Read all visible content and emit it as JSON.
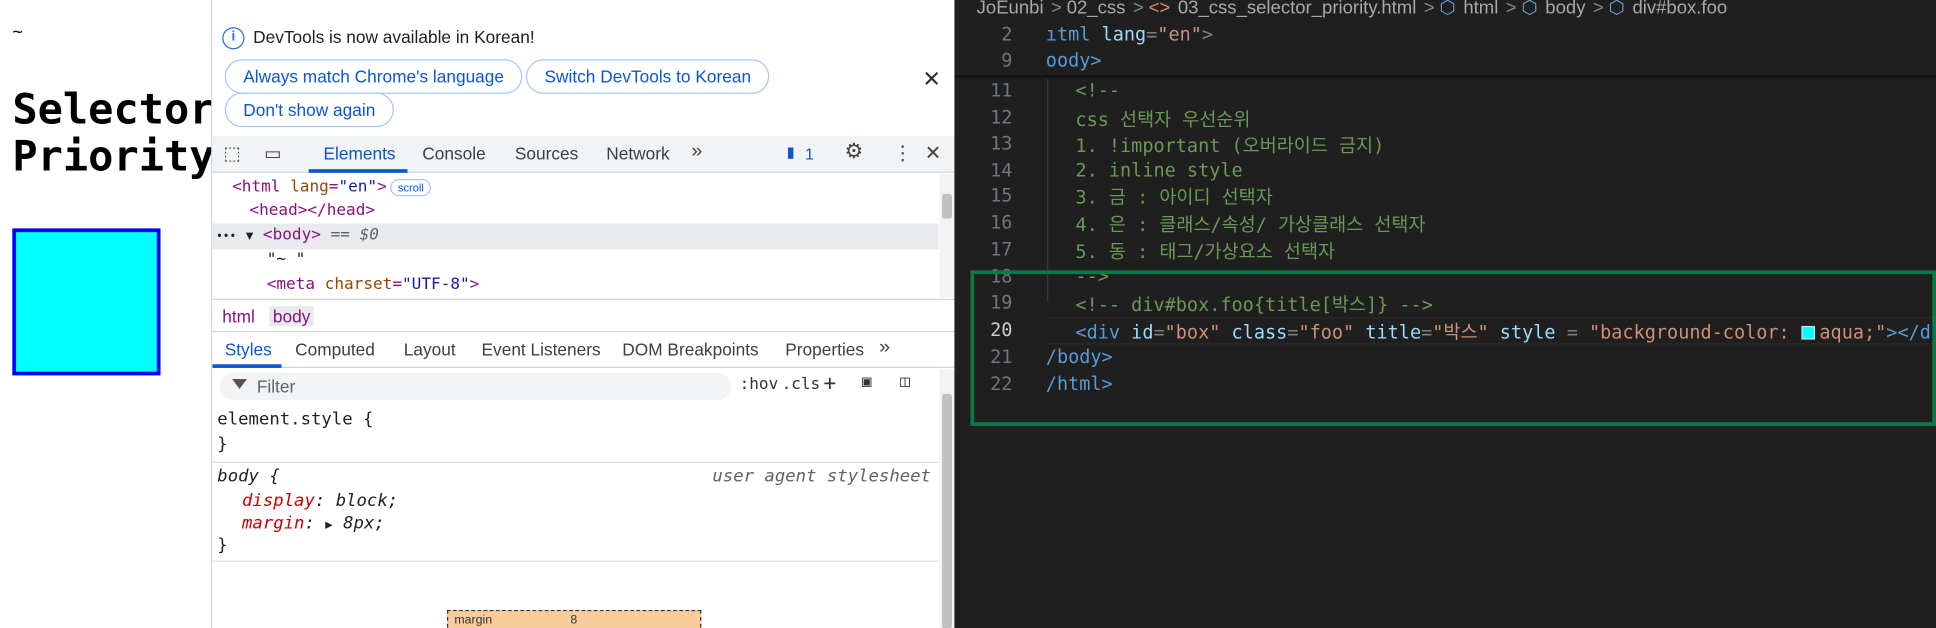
{
  "page": {
    "tilde": "~",
    "heading_line1": "Selector",
    "heading_line2": "Priority",
    "box_color": "#00ffff",
    "box_border_color": "#0000ff"
  },
  "devtools": {
    "infobar": {
      "message": "DevTools is now available in Korean!",
      "btn_match": "Always match Chrome's language",
      "btn_switch": "Switch DevTools to Korean",
      "btn_dont_show": "Don't show again"
    },
    "tabs": [
      "Elements",
      "Console",
      "Sources",
      "Network"
    ],
    "issues_count": "1",
    "elements": {
      "html_open_tag": "<html ",
      "html_attr_name": "lang",
      "html_attr_eq": "=",
      "html_attr_value": "\"en\"",
      "html_close_bracket": ">",
      "scroll_badge": "scroll",
      "head": "<head></head>",
      "body_dots": "•••",
      "body_arrow": "▼",
      "body_tag": "<body>",
      "body_ref": "== $0",
      "text_node": "\"~ \"",
      "meta_open": "<meta ",
      "meta_attr": "charset",
      "meta_eq": "=",
      "meta_value": "\"UTF-8\"",
      "meta_close": ">"
    },
    "breadcrumbs": [
      "html",
      "body"
    ],
    "subtabs": [
      "Styles",
      "Computed",
      "Layout",
      "Event Listeners",
      "DOM Breakpoints",
      "Properties"
    ],
    "filter_placeholder": "Filter",
    "tools": {
      "hov": ":hov",
      "cls": ".cls"
    },
    "styles": {
      "element_style": "element.style {",
      "close_brace": "}",
      "body_rule": "body {",
      "user_agent": "user agent stylesheet",
      "display_prop": "display",
      "display_val": "block;",
      "margin_prop": "margin",
      "margin_val": "8px;",
      "colon": ":",
      "expand_arrow": "▶"
    },
    "box_model": {
      "label": "margin",
      "value": "8"
    }
  },
  "vscode": {
    "breadcrumb": [
      "JoEunbi",
      "02_css",
      "03_css_selector_priority.html",
      "html",
      "body",
      "div#box.foo"
    ],
    "active_line": "20",
    "lines": [
      {
        "n": "2",
        "a": "ıtml ",
        "b": "lang",
        "c": "=",
        "d": "\"en\"",
        "e": ">"
      },
      {
        "n": "9",
        "a": "oody>"
      },
      {
        "n": "11",
        "text": "<!--"
      },
      {
        "n": "12",
        "text": "css 선택자 우선순위"
      },
      {
        "n": "13",
        "text": "1. !important (오버라이드 금지)"
      },
      {
        "n": "14",
        "text": "2. inline style"
      },
      {
        "n": "15",
        "text": "3. 금 : 아이디 선택자"
      },
      {
        "n": "16",
        "text": "4. 은 : 클래스/속성/ 가상클래스 선택자"
      },
      {
        "n": "17",
        "text": "5. 동 : 태그/가상요소 선택자"
      },
      {
        "n": "18",
        "text": "-->"
      },
      {
        "n": "19",
        "text": "<!-- div#box.foo{title[박스]} -->"
      },
      {
        "n": "20",
        "t1": "<div ",
        "id_n": "id",
        "id_v": "\"box\"",
        "cls_n": "class",
        "cls_v": "\"foo\"",
        "title_n": "title",
        "title_v": "\"박스\"",
        "style_n": "style",
        "style_eq": " = ",
        "style_v1": "\"background-color: ",
        "style_v2": "aqua;\"",
        "t_end": "></di"
      },
      {
        "n": "21",
        "text": "/body>"
      },
      {
        "n": "22",
        "text": "/html>"
      }
    ],
    "highlight_color": "#0a7a4a",
    "swatch_color": "#00ffff"
  }
}
